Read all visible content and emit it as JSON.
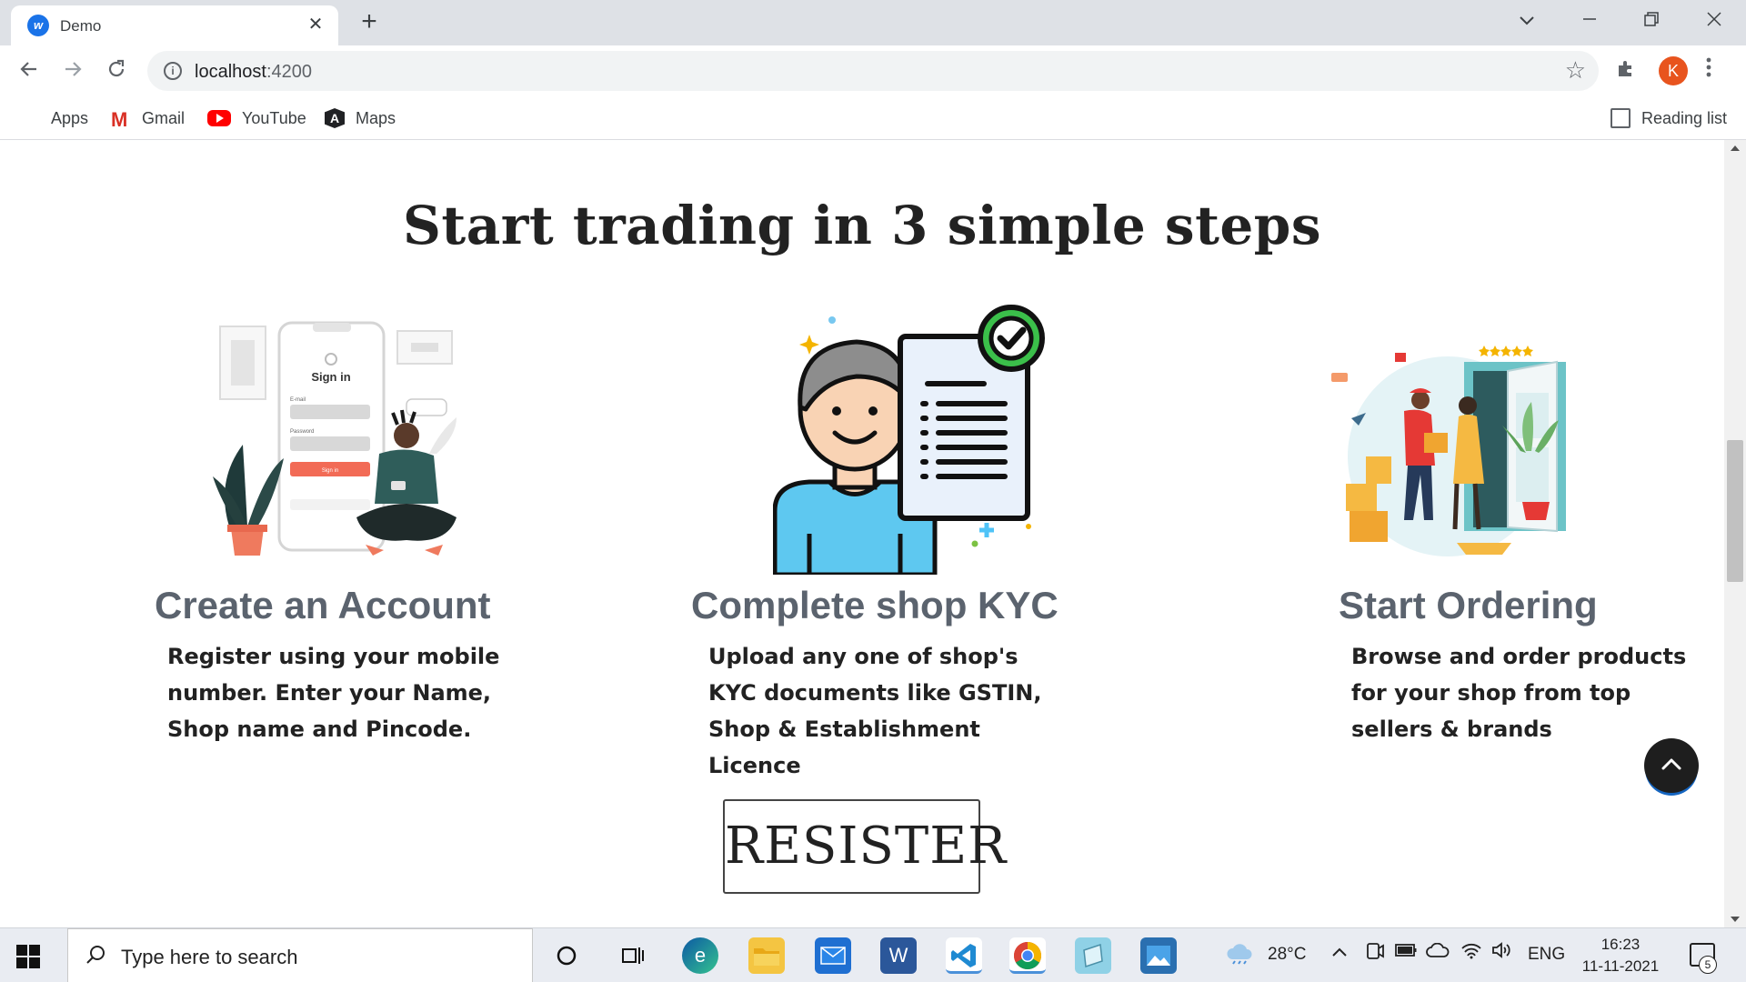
{
  "browser": {
    "tab_title": "Demo",
    "tab_favicon_letter": "w",
    "tab_close_glyph": "✕",
    "new_tab_glyph": "+",
    "url_host": "localhost",
    "url_port": ":4200",
    "profile_initial": "K",
    "bookmarks": {
      "apps": "Apps",
      "gmail": "Gmail",
      "youtube": "YouTube",
      "maps": "Maps",
      "reading_list": "Reading list"
    }
  },
  "page": {
    "headline": "Start trading in 3 simple steps",
    "steps": [
      {
        "title": "Create an Account",
        "description": "Register using your mobile number. Enter your Name, Shop name and Pincode.",
        "illustration": {
          "phone_heading": "Sign in",
          "email_label": "E-mail",
          "password_label": "Password",
          "button_label": "Sign in"
        }
      },
      {
        "title": "Complete shop KYC",
        "description": "Upload any one of shop's KYC documents like GSTIN, Shop & Establishment Licence"
      },
      {
        "title": "Start Ordering",
        "description": "Browse and order products for your shop from top sellers & brands"
      }
    ],
    "register_label": "RESISTER",
    "scroll_top_icon": "chevron-up-icon"
  },
  "taskbar": {
    "search_placeholder": "Type here to search",
    "temperature": "28°C",
    "language": "ENG",
    "time": "16:23",
    "date": "11-11-2021",
    "notification_count": "5"
  },
  "colors": {
    "step_title": "#5b636e",
    "headline": "#222222",
    "profile": "#e8541e",
    "kyc_shirt": "#5ec8f0",
    "kyc_check": "#3bbf4a"
  }
}
